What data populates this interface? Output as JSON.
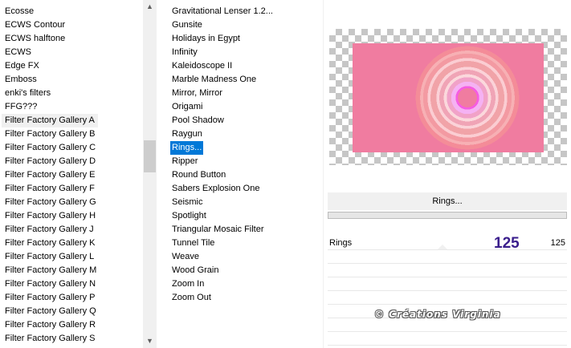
{
  "categories": {
    "items": [
      "Ecosse",
      "ECWS Contour",
      "ECWS halftone",
      "ECWS",
      "Edge FX",
      "Emboss",
      "enki's filters",
      "FFG???",
      "Filter Factory Gallery A",
      "Filter Factory Gallery B",
      "Filter Factory Gallery C",
      "Filter Factory Gallery D",
      "Filter Factory Gallery E",
      "Filter Factory Gallery F",
      "Filter Factory Gallery G",
      "Filter Factory Gallery H",
      "Filter Factory Gallery J",
      "Filter Factory Gallery K",
      "Filter Factory Gallery L",
      "Filter Factory Gallery M",
      "Filter Factory Gallery N",
      "Filter Factory Gallery P",
      "Filter Factory Gallery Q",
      "Filter Factory Gallery R",
      "Filter Factory Gallery S"
    ],
    "selected_index": 8,
    "scroll_up_icon": "triangle-up-icon",
    "scroll_down_icon": "triangle-down-icon"
  },
  "filters": {
    "items": [
      "Gravitational Lenser 1.2...",
      "Gunsite",
      "Holidays in Egypt",
      "Infinity",
      "Kaleidoscope II",
      "Marble Madness One",
      "Mirror, Mirror",
      "Origami",
      "Pool Shadow",
      "Raygun",
      "Rings...",
      "Ripper",
      "Round Button",
      "Sabers Explosion One",
      "Seismic",
      "Spotlight",
      "Triangular Mosaic Filter",
      "Tunnel Tile",
      "Weave",
      "Wood Grain",
      "Zoom In",
      "Zoom Out"
    ],
    "selected_index": 10
  },
  "preview": {
    "rect_color": "#f07ca0"
  },
  "banner": {
    "title": "Rings..."
  },
  "params": {
    "label": "Rings",
    "annotated_value": "125",
    "value": "125"
  },
  "watermark": {
    "text": "© Créations Virginia"
  }
}
